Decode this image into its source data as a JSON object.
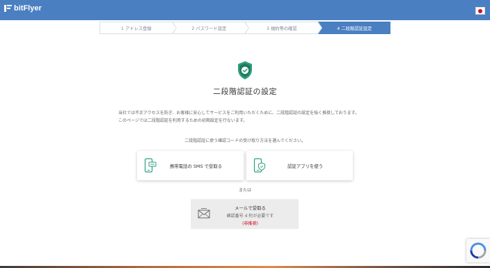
{
  "header": {
    "brand": "bitFlyer",
    "brand_color": "#4a7fc1",
    "language_flag": "japan-flag-icon"
  },
  "steps": [
    {
      "label": "1 アドレス登録",
      "active": false
    },
    {
      "label": "2 パスワード設定",
      "active": false
    },
    {
      "label": "3 規約等の確認",
      "active": false
    },
    {
      "label": "4 二段階認証設定",
      "active": true
    }
  ],
  "main": {
    "icon": "shield-check-icon",
    "title": "二段階認証の設定",
    "description_line1": "当社では不正アクセスを防ぎ、お客様に安心してサービスをご利用いただくために、二段階認証の設定を強く推奨しております。",
    "description_line2": "このページでは二段階認証を利用するための初期設定を行ないます。",
    "prompt": "二段階認証に使う確認コードの受け取り方法を選んでください。"
  },
  "options": {
    "sms": {
      "label": "携帯電話の SMS で受取る",
      "icon": "mobile-phone-icon"
    },
    "app": {
      "label": "認証アプリを使う",
      "icon": "phone-shield-icon"
    }
  },
  "or_label": "または",
  "email_option": {
    "title": "メールで受取る",
    "note": "確認番号 4 桁が必要です",
    "tag": "(非推奨)",
    "icon": "envelope-icon",
    "tag_color": "#d0021b"
  },
  "accent_color": "#2e9e7e",
  "recaptcha": {
    "icon": "recaptcha-icon"
  }
}
